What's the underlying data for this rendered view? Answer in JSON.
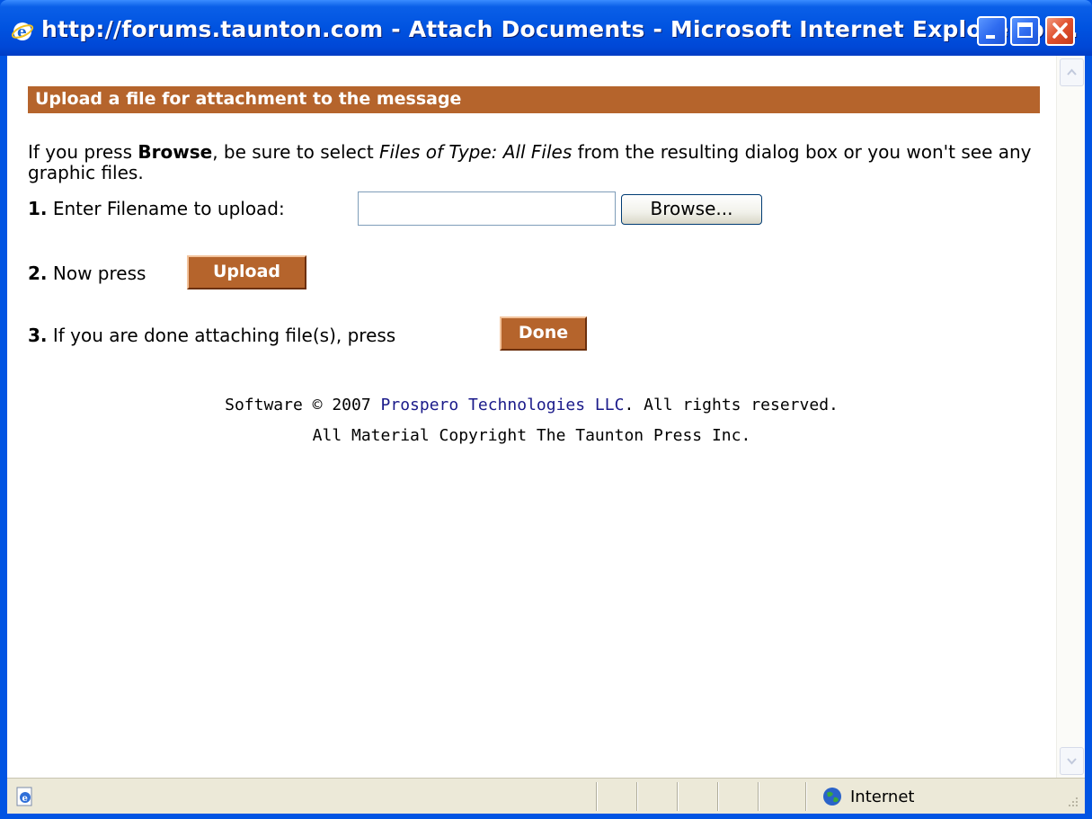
{
  "window": {
    "title": "http://forums.taunton.com - Attach Documents - Microsoft Internet Explorer pr..."
  },
  "page": {
    "header": "Upload a file for attachment to the message",
    "instructions": {
      "part1": "If you press ",
      "browse_word": "Browse",
      "part2": ", be sure to select ",
      "files_type": "Files of Type: All Files",
      "part3": " from the resulting dialog box or you won't see any graphic files."
    },
    "step1": {
      "number": "1.",
      "label": " Enter Filename to upload:",
      "filename_value": "",
      "browse_label": "Browse..."
    },
    "step2": {
      "number": "2.",
      "label": " Now press",
      "upload_label": "Upload"
    },
    "step3": {
      "number": "3.",
      "label": " If you are done attaching file(s), press",
      "done_label": "Done"
    },
    "footer": {
      "line1_prefix": "Software © 2007 ",
      "line1_link": "Prospero Technologies LLC",
      "line1_suffix": ".  All rights reserved.",
      "line2": "All Material Copyright The Taunton Press Inc."
    }
  },
  "statusbar": {
    "zone": "Internet",
    "zone_icon": "globe-icon",
    "page_icon": "ie-page-icon"
  },
  "colors": {
    "header_bg": "#b5642c",
    "titlebar": "#0054e3",
    "link": "#1a1a8a"
  }
}
